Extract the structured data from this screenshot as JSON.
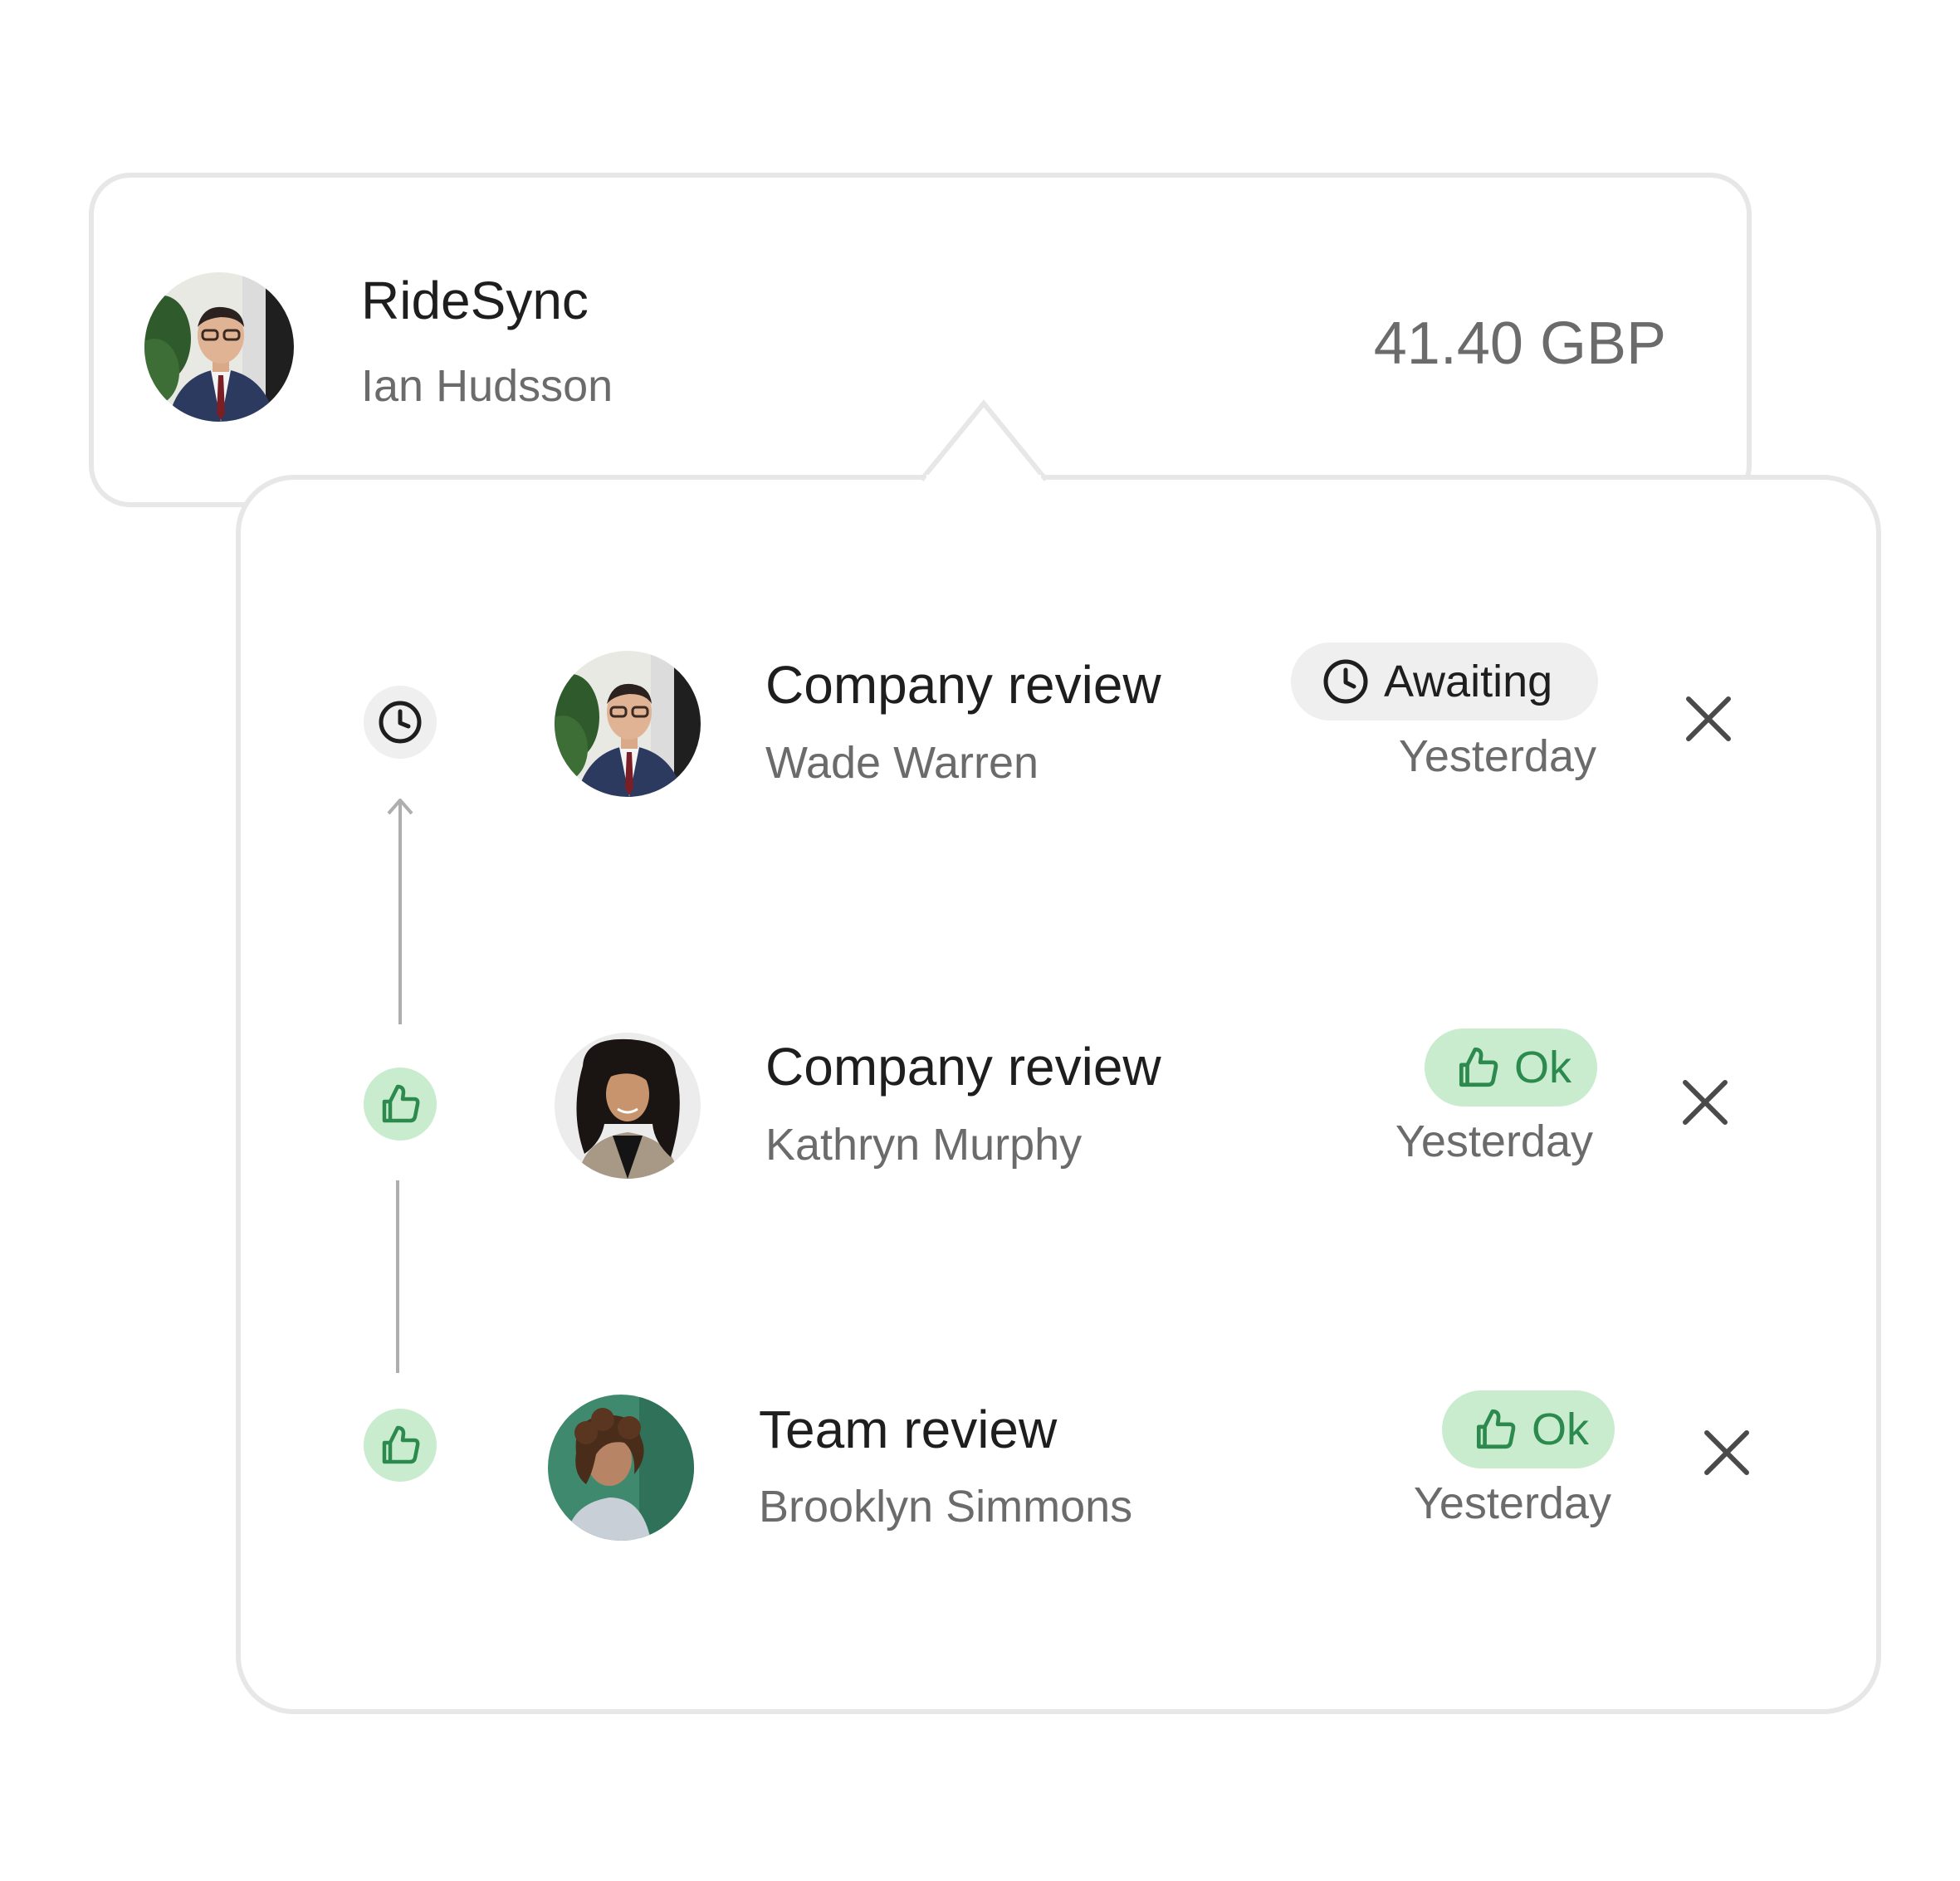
{
  "header": {
    "title": "RideSync",
    "subtitle": "Ian Hudsson",
    "amount": "41.40 GBP",
    "avatar": "avatar-man-suit-glasses"
  },
  "colors": {
    "border": "#e7e7e7",
    "text_primary": "#1e1e1e",
    "text_secondary": "#6b6b6b",
    "ok_background": "#c9eccf",
    "ok_foreground": "#2d8a4e",
    "pending_background": "#efefef",
    "timeline_line": "#aeaeae"
  },
  "timeline": [
    {
      "status": "pending",
      "icon": "clock-icon"
    },
    {
      "status": "approved",
      "icon": "thumbs-up-icon"
    },
    {
      "status": "approved",
      "icon": "thumbs-up-icon"
    }
  ],
  "reviews": [
    {
      "title": "Company review",
      "reviewer": "Wade Warren",
      "status_label": "Awaiting",
      "status_icon": "clock-icon",
      "date": "Yesterday",
      "avatar": "avatar-man-suit-glasses"
    },
    {
      "title": "Company review",
      "reviewer": "Kathryn Murphy",
      "status_label": "Ok",
      "status_icon": "thumbs-up-icon",
      "date": "Yesterday",
      "avatar": "avatar-woman-dark-curly-hair"
    },
    {
      "title": "Team review",
      "reviewer": "Brooklyn Simmons",
      "status_label": "Ok",
      "status_icon": "thumbs-up-icon",
      "date": "Yesterday",
      "avatar": "avatar-woman-curly-hair-green-bg"
    }
  ]
}
